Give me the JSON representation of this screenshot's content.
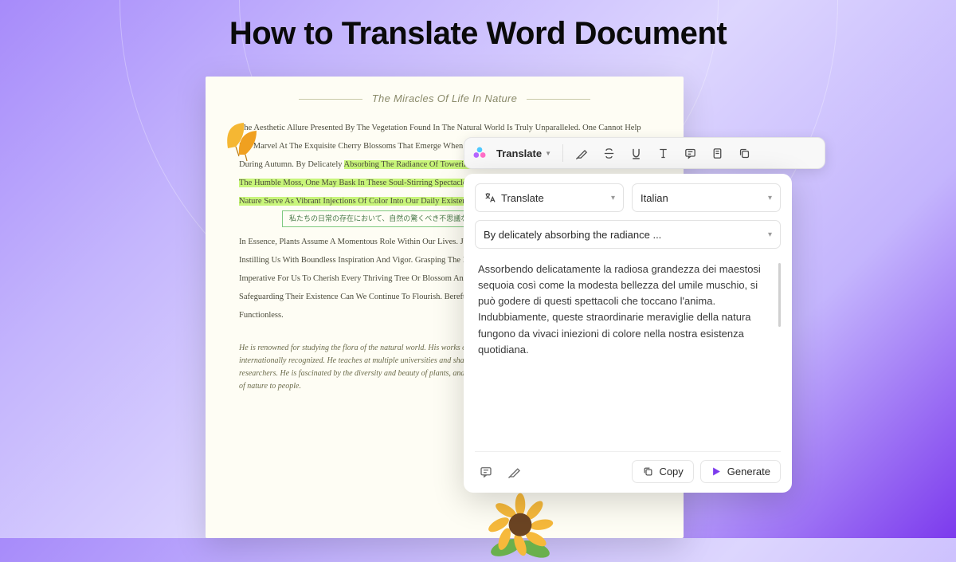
{
  "page": {
    "title": "How to Translate Word Document"
  },
  "document": {
    "title": "The Miracles Of Life In Nature",
    "para1": "The Aesthetic Allure Presented By The Vegetation Found In The Natural World Is Truly Unparalleled. One Cannot Help But Marvel At The Exquisite Cherry Blossoms That Emerge When Springs Or The Vivid Hues That Drench Maple Leaves During Autumn. By Delicately",
    "highlight": "Absorbing The Radiance Of Towering Sequoias As Well As The Unassuming Beauty Of The Humble Moss, One May Bask In These Soul-Stirring Spectacles. Undoubtedly, These Remarkable Wonders Of Nature Serve As Vibrant Injections Of Color Into Our Daily Existence.",
    "japanese": "私たちの日常の存在において、自然の驚くべき不思議な色が活気に満ちた刺激を提供します。",
    "para2": "In Essence, Plants Assume A Momentous Role Within Our Lives. Just Like Dear Companions, They Silently Offer Solace, Instilling Us With Boundless Inspiration And Vigor. Grasping The Invaluable Essence Of Our Surroundings, It Becomes Imperative For Us To Cherish Every Thriving Tree Or Blossom And Ensure Their Preservation. Only Through Safeguarding Their Existence Can We Continue To Flourish. Bereft Of Plants, Our Lives Would Be Rendered Functionless.",
    "handwriting": "He is renowned for studying the flora of the natural world. His works on plant classification, features, and ecology are internationally recognized. He teaches at multiple universities and shares his knowledge and passion for botany with young researchers. He is fascinated by the diversity and beauty of plants, and continues his writing activities to convey the importance of nature to people."
  },
  "toolbar": {
    "translate_label": "Translate"
  },
  "panel": {
    "action_label": "Translate",
    "language": "Italian",
    "source_preview": "By delicately absorbing the radiance ...",
    "output": "Assorbendo delicatamente la radiosa grandezza dei maestosi sequoia così come la modesta bellezza del umile muschio, si può godere di questi spettacoli che toccano l'anima. Indubbiamente, queste straordinarie meraviglie della natura fungono da vivaci iniezioni di colore nella nostra esistenza quotidiana.",
    "copy_label": "Copy",
    "generate_label": "Generate"
  }
}
